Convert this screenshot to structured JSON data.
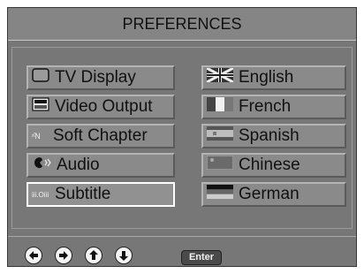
{
  "title": "PREFERENCES",
  "menu": {
    "items": [
      {
        "label": "TV Display",
        "icon": "tv-icon"
      },
      {
        "label": "Video Output",
        "icon": "video-output-icon"
      },
      {
        "label": "Soft Chapter",
        "icon": "soft-chapter-icon",
        "icon_text": "ⁿ̂N"
      },
      {
        "label": "Audio",
        "icon": "audio-icon"
      },
      {
        "label": "Subtitle",
        "icon": "subtitle-icon",
        "icon_text": "iii.Oiii"
      }
    ],
    "selected_index": 4
  },
  "options": {
    "items": [
      {
        "label": "English",
        "icon": "uk-flag-icon"
      },
      {
        "label": "French",
        "icon": "french-flag-icon"
      },
      {
        "label": "Spanish",
        "icon": "spanish-flag-icon"
      },
      {
        "label": "Chinese",
        "icon": "chinese-flag-icon"
      },
      {
        "label": "German",
        "icon": "german-flag-icon"
      }
    ]
  },
  "footer": {
    "nav_icons": [
      "left-arrow-icon",
      "right-arrow-icon",
      "up-arrow-icon",
      "down-arrow-icon"
    ],
    "enter_label": "Enter"
  },
  "colors": {
    "background": "#777777",
    "selected_border": "#ffffff"
  }
}
